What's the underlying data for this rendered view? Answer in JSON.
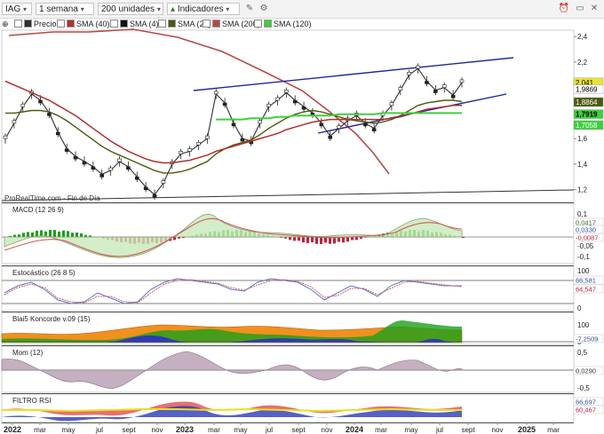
{
  "toolbar": {
    "symbol": "IAG",
    "period": "1 semana",
    "units": "200 unidades",
    "indicators": "Indicadores"
  },
  "legend": [
    {
      "label": "Precio",
      "color": "#2f2f2f"
    },
    {
      "label": "SMA (40)",
      "color": "#b03030"
    },
    {
      "label": "SMA (4)",
      "color": "#111111"
    },
    {
      "label": "SMA (20)",
      "color": "#4a5a10"
    },
    {
      "label": "SMA (200)",
      "color": "#b84848"
    },
    {
      "label": "SMA (120)",
      "color": "#3cd03c"
    }
  ],
  "source_label": "ProRealTime.com - Fin de Día",
  "price_badges": [
    {
      "text": "2,041",
      "value": 2.041,
      "bg": "#e9e236",
      "fg": "#000000"
    },
    {
      "text": "1,9869",
      "value": 1.9869,
      "bg": "#ffffff",
      "fg": "#000000"
    },
    {
      "text": "1,8864",
      "value": 1.8864,
      "bg": "#4a5a10",
      "fg": "#ffffff"
    },
    {
      "text": "1,7919",
      "value": 1.7919,
      "bg": "#3cd03c",
      "fg": "#000000"
    },
    {
      "text": "1,7058",
      "value": 1.7058,
      "bg": "#3cd03c",
      "fg": "#ffffff"
    }
  ],
  "panels": {
    "macd": {
      "title": "MACD (12 26 9)",
      "badges": [
        "0,0417",
        "0,0330",
        "-0,0087"
      ]
    },
    "stoch": {
      "title": "Estocástico (26 8 5)",
      "badges": [
        "66,581",
        "64,547"
      ]
    },
    "koncorde": {
      "title": "Blai5 Koncorde v.09 (15)",
      "badges": [
        "-7,2509"
      ]
    },
    "mom": {
      "title": "Mom (12)",
      "badges": [
        "0,0290"
      ]
    },
    "rsi": {
      "title": "FILTRO RSI",
      "badges": [
        "66,697",
        "60,467"
      ]
    }
  },
  "chart_data": {
    "type": "line",
    "title": "IAG",
    "x_labels": [
      "2022",
      "mar",
      "may",
      "jul",
      "sept",
      "nov",
      "2023",
      "mar",
      "may",
      "jul",
      "sept",
      "nov",
      "2024",
      "mar",
      "may",
      "jul",
      "sept",
      "nov",
      "2025",
      "mar"
    ],
    "price_axis": {
      "ticks": [
        "2,4",
        "2,2",
        "2",
        "1,8",
        "1,6",
        "1,4",
        "1,2"
      ],
      "ylim": [
        1.1,
        2.45
      ]
    },
    "macd_axis": {
      "ticks": [
        "0,1",
        "-0,05",
        "-0,1"
      ]
    },
    "stoch_axis": {
      "ticks": [
        "100",
        "50",
        "0"
      ]
    },
    "koncorde_axis": {
      "ticks": [
        "100",
        "0"
      ]
    },
    "mom_axis": {
      "ticks": [
        "0,5",
        "-0,5"
      ]
    },
    "rsi_axis": {
      "ticks": [
        "50"
      ]
    },
    "price_series": [
      {
        "name": "Precio",
        "values": [
          1.6,
          1.72,
          1.85,
          1.95,
          1.9,
          1.8,
          1.65,
          1.52,
          1.46,
          1.42,
          1.38,
          1.32,
          1.35,
          1.42,
          1.38,
          1.3,
          1.22,
          1.16,
          1.25,
          1.4,
          1.48,
          1.5,
          1.55,
          1.6,
          1.95,
          1.88,
          1.72,
          1.6,
          1.58,
          1.72,
          1.85,
          1.9,
          1.96,
          1.9,
          1.85,
          1.8,
          1.72,
          1.62,
          1.68,
          1.74,
          1.78,
          1.72,
          1.68,
          1.78,
          1.86,
          1.98,
          2.1,
          2.15,
          2.05,
          1.98,
          2.0,
          1.94,
          2.04
        ]
      },
      {
        "name": "SMA (20)",
        "values": [
          1.8,
          1.8,
          1.81,
          1.82,
          1.82,
          1.81,
          1.78,
          1.74,
          1.69,
          1.64,
          1.59,
          1.54,
          1.5,
          1.47,
          1.44,
          1.41,
          1.38,
          1.35,
          1.33,
          1.33,
          1.34,
          1.36,
          1.39,
          1.42,
          1.48,
          1.52,
          1.55,
          1.57,
          1.59,
          1.63,
          1.68,
          1.72,
          1.76,
          1.79,
          1.81,
          1.82,
          1.81,
          1.79,
          1.77,
          1.75,
          1.74,
          1.73,
          1.72,
          1.73,
          1.75,
          1.78,
          1.82,
          1.86,
          1.88,
          1.89,
          1.9,
          1.9,
          1.89
        ]
      },
      {
        "name": "SMA (40)",
        "values": [
          2.05,
          2.02,
          1.99,
          1.96,
          1.93,
          1.9,
          1.86,
          1.82,
          1.78,
          1.73,
          1.68,
          1.63,
          1.58,
          1.54,
          1.5,
          1.47,
          1.44,
          1.42,
          1.41,
          1.41,
          1.42,
          1.43,
          1.45,
          1.47,
          1.5,
          1.52,
          1.54,
          1.56,
          1.58,
          1.6,
          1.62,
          1.64,
          1.67,
          1.69,
          1.71,
          1.73,
          1.74,
          1.75,
          1.75,
          1.75,
          1.75,
          1.75,
          1.75,
          1.75,
          1.76,
          1.77,
          1.79,
          1.81,
          1.83,
          1.84,
          1.85,
          1.86,
          1.86
        ]
      },
      {
        "name": "SMA (120)",
        "values": [
          null,
          null,
          null,
          null,
          null,
          null,
          null,
          null,
          null,
          null,
          null,
          null,
          null,
          null,
          null,
          null,
          null,
          null,
          null,
          null,
          null,
          null,
          null,
          null,
          1.75,
          1.75,
          1.75,
          1.75,
          1.76,
          1.76,
          1.76,
          1.77,
          1.77,
          1.78,
          1.78,
          1.78,
          1.78,
          1.78,
          1.79,
          1.79,
          1.79,
          1.79,
          1.79,
          1.8,
          1.8,
          1.8,
          1.8,
          1.8,
          1.8,
          1.8,
          1.8,
          1.8,
          1.8
        ]
      }
    ]
  }
}
